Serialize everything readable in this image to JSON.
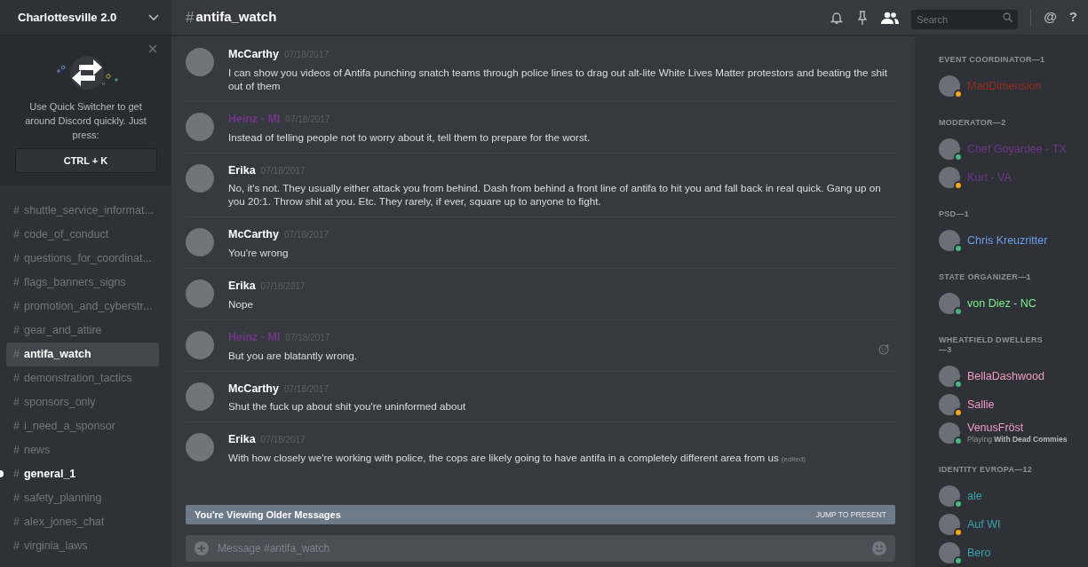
{
  "server": {
    "name": "Charlottesville 2.0"
  },
  "quick_switcher": {
    "text": "Use Quick Switcher to get around Discord quickly. Just press:",
    "key": "CTRL + K"
  },
  "channels": [
    {
      "prefix": "#",
      "name": "shuttle_service_informat...",
      "selected": false,
      "unread": false
    },
    {
      "prefix": "#",
      "name": "code_of_conduct",
      "selected": false,
      "unread": false
    },
    {
      "prefix": "#",
      "name": "questions_for_coordinat...",
      "selected": false,
      "unread": false
    },
    {
      "prefix": "#",
      "name": "flags_banners_signs",
      "selected": false,
      "unread": false
    },
    {
      "prefix": "#",
      "name": "promotion_and_cyberstr...",
      "selected": false,
      "unread": false
    },
    {
      "prefix": "#",
      "name": "gear_and_attire",
      "selected": false,
      "unread": false
    },
    {
      "prefix": "#",
      "name": "antifa_watch",
      "selected": true,
      "unread": false
    },
    {
      "prefix": "#",
      "name": "demonstration_tactics",
      "selected": false,
      "unread": false
    },
    {
      "prefix": "#",
      "name": "sponsors_only",
      "selected": false,
      "unread": false
    },
    {
      "prefix": "#",
      "name": "i_need_a_sponsor",
      "selected": false,
      "unread": false
    },
    {
      "prefix": "#",
      "name": "news",
      "selected": false,
      "unread": false
    },
    {
      "prefix": "#",
      "name": "general_1",
      "selected": false,
      "unread": true
    },
    {
      "prefix": "#",
      "name": "safety_planning",
      "selected": false,
      "unread": false
    },
    {
      "prefix": "#",
      "name": "alex_jones_chat",
      "selected": false,
      "unread": false
    },
    {
      "prefix": "#",
      "name": "virginia_laws",
      "selected": false,
      "unread": false
    }
  ],
  "header": {
    "hash": "#",
    "channel": "antifa_watch",
    "search_placeholder": "Search",
    "at": "@",
    "help": "?"
  },
  "messages": [
    {
      "author": "McCarthy",
      "color": "#ffffff",
      "time": "07/18/2017",
      "text": "I can show you videos of Antifa punching snatch teams through police lines to drag out alt-lite White Lives Matter protestors and beating the shit out of them",
      "reaction_button": false
    },
    {
      "author": "Heinz - MI",
      "color": "#71368a",
      "time": "07/18/2017",
      "text": "Instead of telling people not to worry about it, tell them to prepare for the worst.",
      "reaction_button": false
    },
    {
      "author": "Erika",
      "color": "#ffffff",
      "time": "07/18/2017",
      "text": "No, it's not. They usually either attack you from behind. Dash from behind a front line of antifa to hit you and fall back in real quick. Gang up on you 20:1. Throw shit at you. Etc. They rarely, if ever, square up to anyone to fight.",
      "reaction_button": false
    },
    {
      "author": "McCarthy",
      "color": "#ffffff",
      "time": "07/18/2017",
      "text": "You're wrong",
      "reaction_button": false
    },
    {
      "author": "Erika",
      "color": "#ffffff",
      "time": "07/18/2017",
      "text": "Nope",
      "reaction_button": false
    },
    {
      "author": "Heinz - MI",
      "color": "#71368a",
      "time": "07/18/2017",
      "text": "But you are blatantly wrong.",
      "reaction_button": true
    },
    {
      "author": "McCarthy",
      "color": "#ffffff",
      "time": "07/18/2017",
      "text": "Shut the fuck up about shit you're uninformed about",
      "reaction_button": false
    },
    {
      "author": "Erika",
      "color": "#ffffff",
      "time": "07/18/2017",
      "text": "With how closely we're working with police, the cops are likely going to have antifa in a completely different area from us",
      "edited": "(edited)",
      "reaction_button": false
    }
  ],
  "older_banner": {
    "text": "You're Viewing Older Messages",
    "action": "JUMP TO PRESENT"
  },
  "composer": {
    "placeholder": "Message #antifa_watch"
  },
  "member_groups": [
    {
      "title": "EVENT COORDINATOR—1",
      "members": [
        {
          "name": "MadDimension",
          "color": "#992d22",
          "status": {
            "color": "#faa61a"
          }
        }
      ]
    },
    {
      "title": "MODERATOR—2",
      "members": [
        {
          "name": "Chef Goyardee - TX",
          "color": "#71368a",
          "status": {
            "color": "#43b581"
          }
        },
        {
          "name": "Kurt - VA",
          "color": "#71368a",
          "status": {
            "color": "#faa61a"
          }
        }
      ]
    },
    {
      "title": "PSD—1",
      "members": [
        {
          "name": "Chris Kreuzritter",
          "color": "#6d9eeb",
          "status": {
            "color": "#43b581"
          }
        }
      ]
    },
    {
      "title": "STATE ORGANIZER—1",
      "members": [
        {
          "name": "von Diez - NC",
          "color": "#7df38d",
          "status": {
            "color": "#43b581"
          }
        }
      ]
    },
    {
      "title": "WHEATFIELD DWELLERS—3",
      "members": [
        {
          "name": "BellaDashwood",
          "color": "#f49ac8",
          "status": {
            "color": "#43b581"
          }
        },
        {
          "name": "Sallie",
          "color": "#f49ac8",
          "status": {
            "color": "#faa61a"
          }
        },
        {
          "name": "VenusFröst",
          "color": "#f49ac8",
          "status": {
            "color": "#43b581"
          },
          "activity_prefix": "Playing",
          "activity": "With Dead Commies"
        }
      ]
    },
    {
      "title": "IDENTITY EVROPA—12",
      "members": [
        {
          "name": "ale",
          "color": "#3aa3b0",
          "status": {
            "color": "#43b581"
          }
        },
        {
          "name": "Auf WI",
          "color": "#3aa3b0",
          "status": {
            "color": "#faa61a"
          }
        },
        {
          "name": "Bero",
          "color": "#3aa3b0",
          "status": {
            "color": "#43b581"
          }
        }
      ]
    }
  ]
}
